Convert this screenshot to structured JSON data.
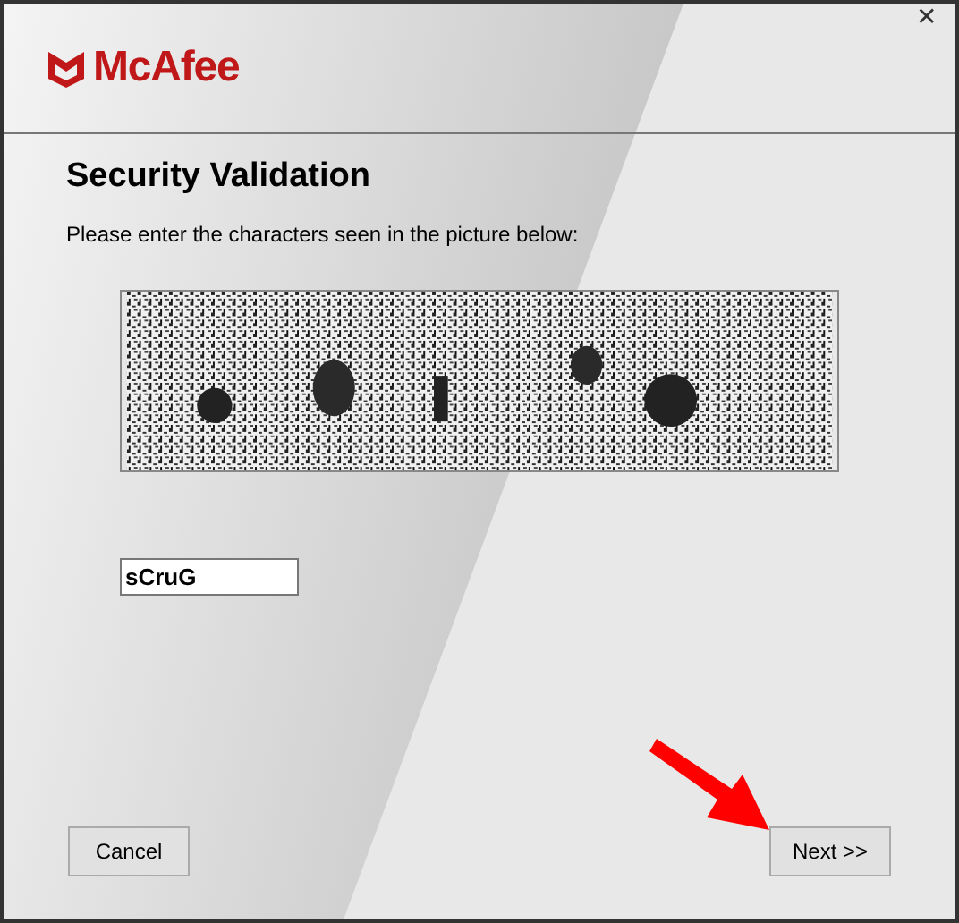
{
  "window": {
    "close": "✕"
  },
  "brand": {
    "name": "McAfee"
  },
  "title": "Security Validation",
  "instruction": "Please enter the characters seen in the picture below:",
  "answer": {
    "value": "sCruG"
  },
  "buttons": [
    {
      "label": "Cancel"
    },
    {
      "label": "Next >>"
    }
  ]
}
